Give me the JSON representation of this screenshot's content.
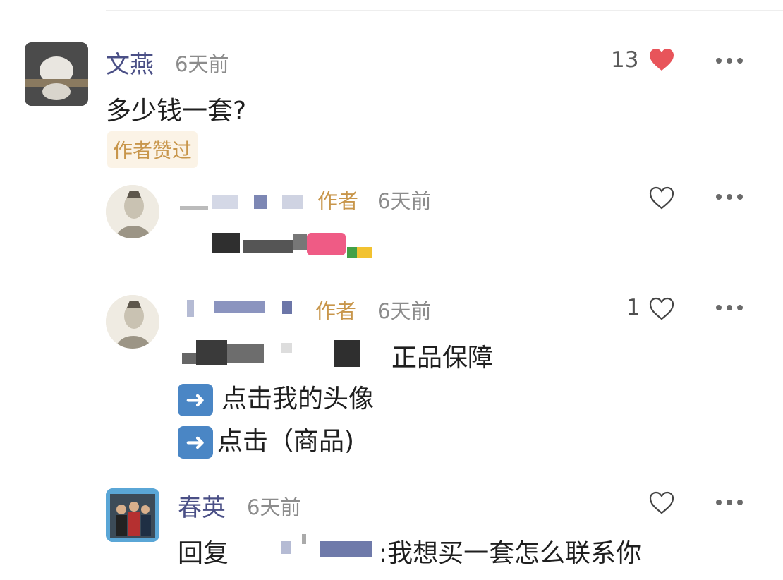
{
  "comments": [
    {
      "name": "文燕",
      "time": "6天前",
      "text": "多少钱一套?",
      "likes": "13",
      "badge": "作者赞过",
      "avatar_icon": "cat-avatar-icon",
      "heart_color": "#e8545a"
    },
    {
      "author_tag": "作者",
      "time": "6天前",
      "avatar_icon": "portrait-avatar-icon"
    },
    {
      "author_tag": "作者",
      "time": "6天前",
      "likes": "1",
      "line1": "正品保障",
      "line2": "点击我的头像",
      "line3": "点击（商品)",
      "arrow_icon": "right-arrow-icon"
    },
    {
      "name": "春英",
      "time": "6天前",
      "reply_prefix": "回复",
      "reply_text": ":我想买一套怎么联系你",
      "avatar_icon": "photo-avatar-icon"
    }
  ],
  "colors": {
    "name": "#4a4f86",
    "author": "#c8964b",
    "heart": "#e8545a"
  }
}
